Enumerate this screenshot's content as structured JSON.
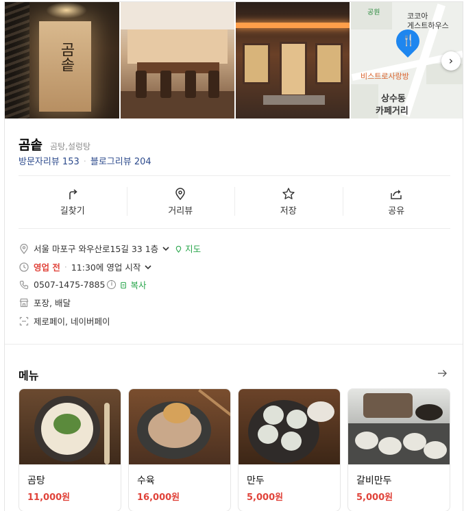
{
  "photos": {
    "sign_text": "곰솥",
    "map": {
      "labels": [
        "공원",
        "코코아",
        "게스트하우스",
        "비스트로사랑방",
        "상수동",
        "카페거리",
        "공원"
      ],
      "pin_glyph": "🍴",
      "next_glyph": "›"
    }
  },
  "place": {
    "name": "곰솥",
    "category": "곰탕,설렁탕",
    "visitor_reviews": "방문자리뷰 153",
    "blog_reviews": "블로그리뷰 204"
  },
  "actions": [
    {
      "label": "길찾기",
      "icon": "directions-icon"
    },
    {
      "label": "거리뷰",
      "icon": "location-pin-icon"
    },
    {
      "label": "저장",
      "icon": "star-icon"
    },
    {
      "label": "공유",
      "icon": "share-icon"
    }
  ],
  "info": {
    "address": "서울 마포구 와우산로15길 33 1층",
    "map_link": "지도",
    "status": "영업 전",
    "open_time": "11:30에 영업 시작",
    "phone": "0507-1475-7885",
    "copy_label": "복사",
    "service": "포장, 배달",
    "payment": "제로페이, 네이버페이"
  },
  "menu": {
    "title": "메뉴",
    "items": [
      {
        "name": "곰탕",
        "price": "11,000원"
      },
      {
        "name": "수육",
        "price": "16,000원"
      },
      {
        "name": "만두",
        "price": "5,000원"
      },
      {
        "name": "갈비만두",
        "price": "5,000원"
      }
    ]
  },
  "colors": {
    "accent_green": "#27a54a",
    "price_red": "#e0433a",
    "review_blue": "#2c4a8c",
    "map_pin": "#1e86ef"
  }
}
